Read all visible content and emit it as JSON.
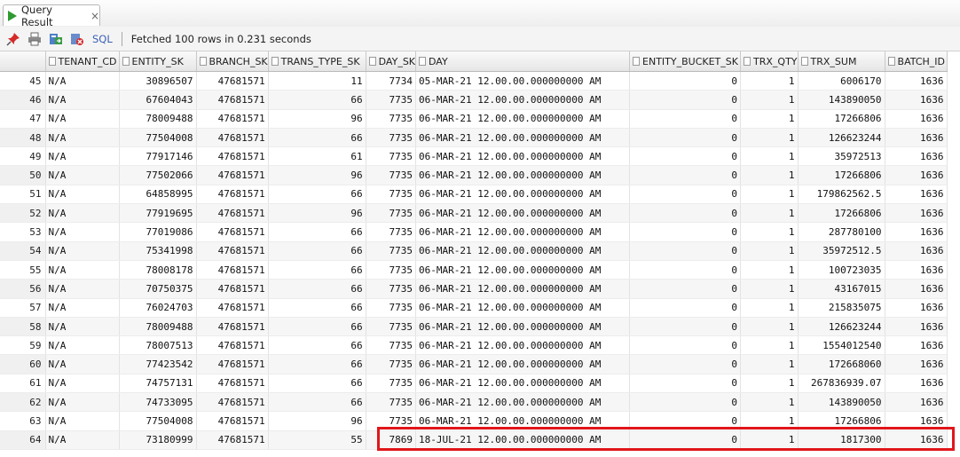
{
  "tab": {
    "label": "Query Result",
    "close": "×"
  },
  "toolbar": {
    "icons": [
      "pin-icon",
      "print-icon",
      "export-icon",
      "delete-icon"
    ],
    "sql_label": "SQL",
    "status": "Fetched 100 rows in 0.231 seconds"
  },
  "columns": [
    "",
    "TENANT_CD",
    "ENTITY_SK",
    "BRANCH_SK",
    "TRANS_TYPE_SK",
    "DAY_SK",
    "DAY",
    "ENTITY_BUCKET_SK",
    "TRX_QTY",
    "TRX_SUM",
    "BATCH_ID"
  ],
  "rows": [
    [
      "45",
      "N/A",
      "30896507",
      "47681571",
      "11",
      "7734",
      "05-MAR-21 12.00.00.000000000 AM",
      "0",
      "1",
      "6006170",
      "1636"
    ],
    [
      "46",
      "N/A",
      "67604043",
      "47681571",
      "66",
      "7735",
      "06-MAR-21 12.00.00.000000000 AM",
      "0",
      "1",
      "143890050",
      "1636"
    ],
    [
      "47",
      "N/A",
      "78009488",
      "47681571",
      "96",
      "7735",
      "06-MAR-21 12.00.00.000000000 AM",
      "0",
      "1",
      "17266806",
      "1636"
    ],
    [
      "48",
      "N/A",
      "77504008",
      "47681571",
      "66",
      "7735",
      "06-MAR-21 12.00.00.000000000 AM",
      "0",
      "1",
      "126623244",
      "1636"
    ],
    [
      "49",
      "N/A",
      "77917146",
      "47681571",
      "61",
      "7735",
      "06-MAR-21 12.00.00.000000000 AM",
      "0",
      "1",
      "35972513",
      "1636"
    ],
    [
      "50",
      "N/A",
      "77502066",
      "47681571",
      "96",
      "7735",
      "06-MAR-21 12.00.00.000000000 AM",
      "0",
      "1",
      "17266806",
      "1636"
    ],
    [
      "51",
      "N/A",
      "64858995",
      "47681571",
      "66",
      "7735",
      "06-MAR-21 12.00.00.000000000 AM",
      "0",
      "1",
      "179862562.5",
      "1636"
    ],
    [
      "52",
      "N/A",
      "77919695",
      "47681571",
      "96",
      "7735",
      "06-MAR-21 12.00.00.000000000 AM",
      "0",
      "1",
      "17266806",
      "1636"
    ],
    [
      "53",
      "N/A",
      "77019086",
      "47681571",
      "66",
      "7735",
      "06-MAR-21 12.00.00.000000000 AM",
      "0",
      "1",
      "287780100",
      "1636"
    ],
    [
      "54",
      "N/A",
      "75341998",
      "47681571",
      "66",
      "7735",
      "06-MAR-21 12.00.00.000000000 AM",
      "0",
      "1",
      "35972512.5",
      "1636"
    ],
    [
      "55",
      "N/A",
      "78008178",
      "47681571",
      "66",
      "7735",
      "06-MAR-21 12.00.00.000000000 AM",
      "0",
      "1",
      "100723035",
      "1636"
    ],
    [
      "56",
      "N/A",
      "70750375",
      "47681571",
      "66",
      "7735",
      "06-MAR-21 12.00.00.000000000 AM",
      "0",
      "1",
      "43167015",
      "1636"
    ],
    [
      "57",
      "N/A",
      "76024703",
      "47681571",
      "66",
      "7735",
      "06-MAR-21 12.00.00.000000000 AM",
      "0",
      "1",
      "215835075",
      "1636"
    ],
    [
      "58",
      "N/A",
      "78009488",
      "47681571",
      "66",
      "7735",
      "06-MAR-21 12.00.00.000000000 AM",
      "0",
      "1",
      "126623244",
      "1636"
    ],
    [
      "59",
      "N/A",
      "78007513",
      "47681571",
      "66",
      "7735",
      "06-MAR-21 12.00.00.000000000 AM",
      "0",
      "1",
      "1554012540",
      "1636"
    ],
    [
      "60",
      "N/A",
      "77423542",
      "47681571",
      "66",
      "7735",
      "06-MAR-21 12.00.00.000000000 AM",
      "0",
      "1",
      "172668060",
      "1636"
    ],
    [
      "61",
      "N/A",
      "74757131",
      "47681571",
      "66",
      "7735",
      "06-MAR-21 12.00.00.000000000 AM",
      "0",
      "1",
      "267836939.07",
      "1636"
    ],
    [
      "62",
      "N/A",
      "74733095",
      "47681571",
      "66",
      "7735",
      "06-MAR-21 12.00.00.000000000 AM",
      "0",
      "1",
      "143890050",
      "1636"
    ],
    [
      "63",
      "N/A",
      "77504008",
      "47681571",
      "96",
      "7735",
      "06-MAR-21 12.00.00.000000000 AM",
      "0",
      "1",
      "17266806",
      "1636"
    ],
    [
      "64",
      "N/A",
      "73180999",
      "47681571",
      "55",
      "7869",
      "18-JUL-21 12.00.00.000000000 AM",
      "0",
      "1",
      "1817300",
      "1636"
    ]
  ],
  "highlight_color": "#e0161b"
}
